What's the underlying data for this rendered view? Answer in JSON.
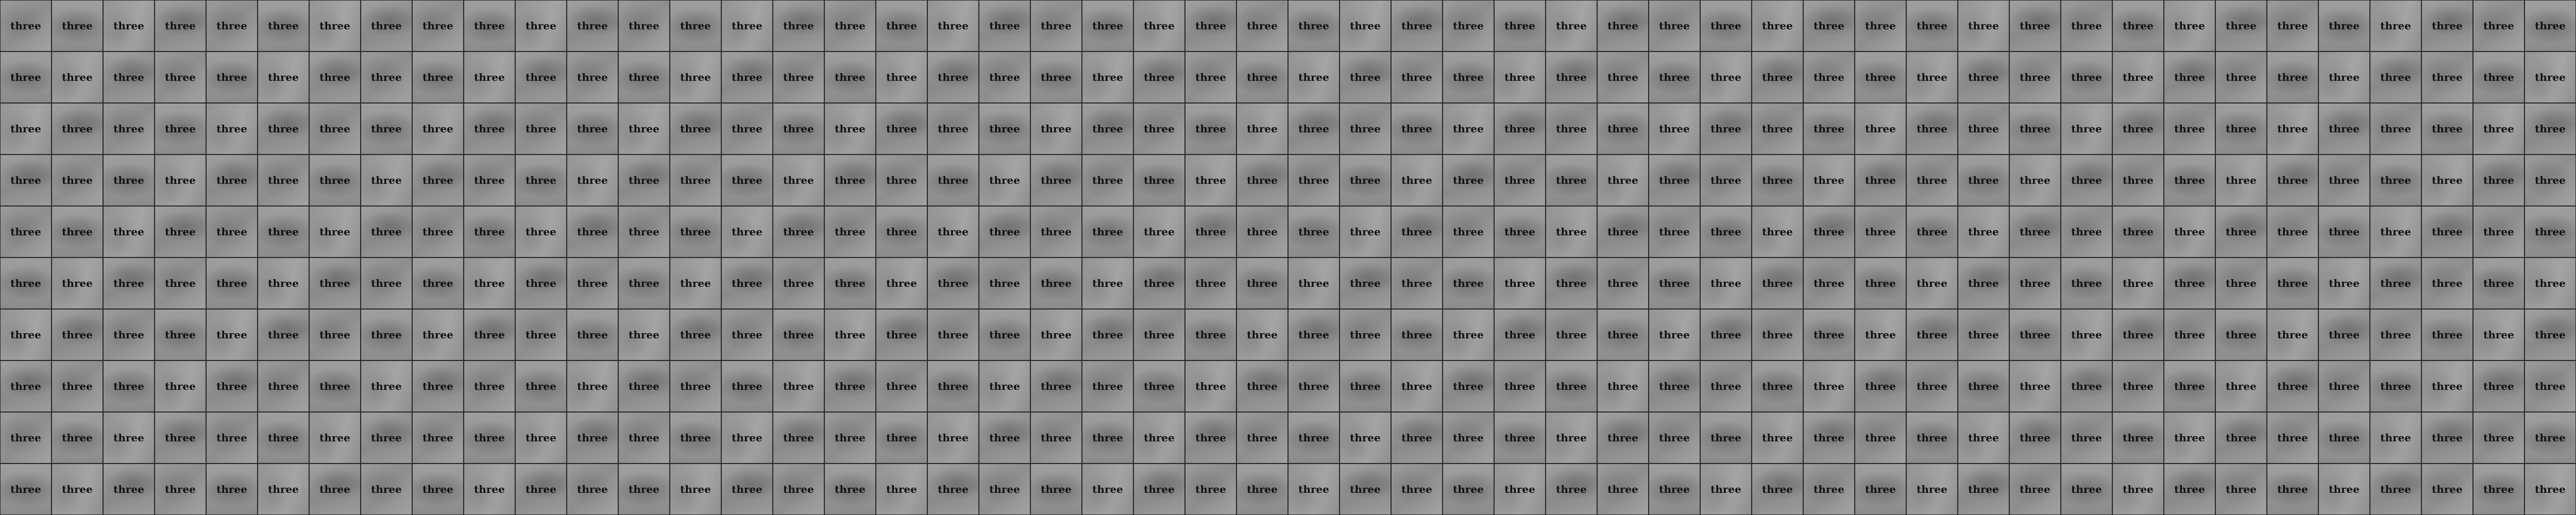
{
  "grid": {
    "rows": 10,
    "columns": 50,
    "tile_label": "three"
  },
  "colors": {
    "tile_base": "#999999",
    "tile_border": "#262626",
    "label": "#111111"
  }
}
